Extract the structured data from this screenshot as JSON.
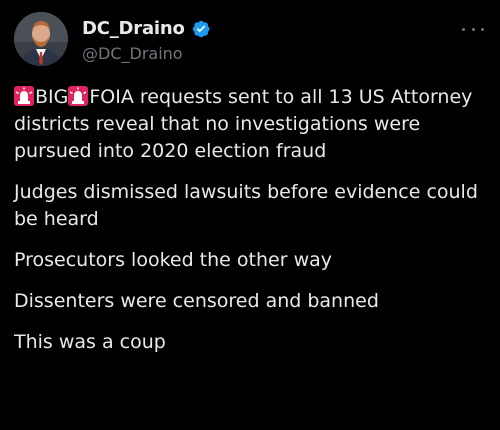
{
  "author": {
    "display_name": "DC_Draino",
    "handle": "@DC_Draino",
    "verified": true,
    "verified_color": "#1d9bf0"
  },
  "icons": {
    "more": "more-horizontal-icon",
    "badge": "verified-badge-icon",
    "siren": "police-car-light-icon"
  },
  "tweet": {
    "line1_word1": "BIG",
    "line1_rest": "FOIA requests sent to all 13 US Attorney districts reveal that no investigations were pursued into 2020 election fraud",
    "para2": "Judges dismissed lawsuits before evidence could be heard",
    "para3": "Prosecutors looked the other way",
    "para4": "Dissenters were censored and banned",
    "para5": "This was a coup"
  },
  "colors": {
    "background": "#000000",
    "text": "#e7e9ea",
    "muted": "#71767b",
    "siren_red": "#e0245e"
  }
}
